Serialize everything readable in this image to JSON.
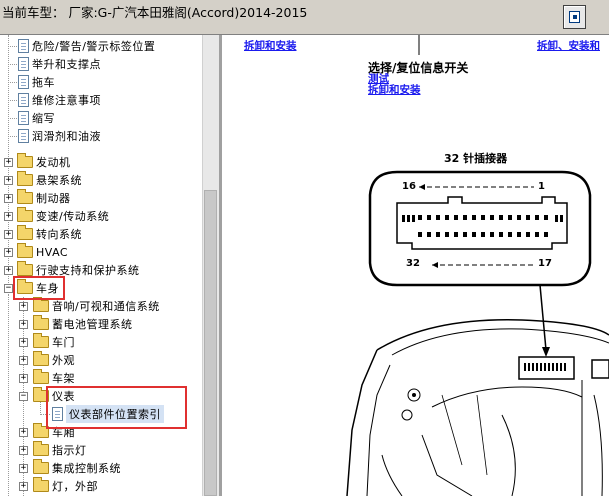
{
  "window": {
    "title": "当前车型： 厂家:G-广汽本田雅阁(Accord)2014-2015"
  },
  "tree": {
    "items": [
      {
        "label": "危险/警告/警示标签位置",
        "type": "doc"
      },
      {
        "label": "举升和支撑点",
        "type": "doc"
      },
      {
        "label": "拖车",
        "type": "doc"
      },
      {
        "label": "维修注意事项",
        "type": "doc"
      },
      {
        "label": "缩写",
        "type": "doc"
      },
      {
        "label": "润滑剂和油液",
        "type": "doc"
      },
      {
        "label": "发动机",
        "type": "folder"
      },
      {
        "label": "悬架系统",
        "type": "folder"
      },
      {
        "label": "制动器",
        "type": "folder"
      },
      {
        "label": "变速/传动系统",
        "type": "folder"
      },
      {
        "label": "转向系统",
        "type": "folder"
      },
      {
        "label": "HVAC",
        "type": "folder"
      },
      {
        "label": "行驶支持和保护系统",
        "type": "folder"
      },
      {
        "label": "车身",
        "type": "folder-open"
      },
      {
        "label": "音响/可视和通信系统",
        "type": "folder"
      },
      {
        "label": "蓄电池管理系统",
        "type": "folder"
      },
      {
        "label": "车门",
        "type": "folder"
      },
      {
        "label": "外观",
        "type": "folder"
      },
      {
        "label": "车架",
        "type": "folder"
      },
      {
        "label": "仪表",
        "type": "folder-open"
      },
      {
        "label": "仪表部件位置索引",
        "type": "doc",
        "selected": true
      },
      {
        "label": "车厢",
        "type": "folder"
      },
      {
        "label": "指示灯",
        "type": "folder"
      },
      {
        "label": "集成控制系统",
        "type": "folder"
      },
      {
        "label": "灯，外部",
        "type": "folder"
      }
    ]
  },
  "content": {
    "top_link_left": "拆卸和安装",
    "top_link_right": "拆卸、安装和",
    "switch_title": "选择/复位信息开关",
    "switch_link_test": "测试",
    "switch_link_install": "拆卸和安装",
    "connector_title": "32 针插接器",
    "pin_16": "16",
    "pin_1": "1",
    "pin_32": "32",
    "pin_17": "17"
  }
}
